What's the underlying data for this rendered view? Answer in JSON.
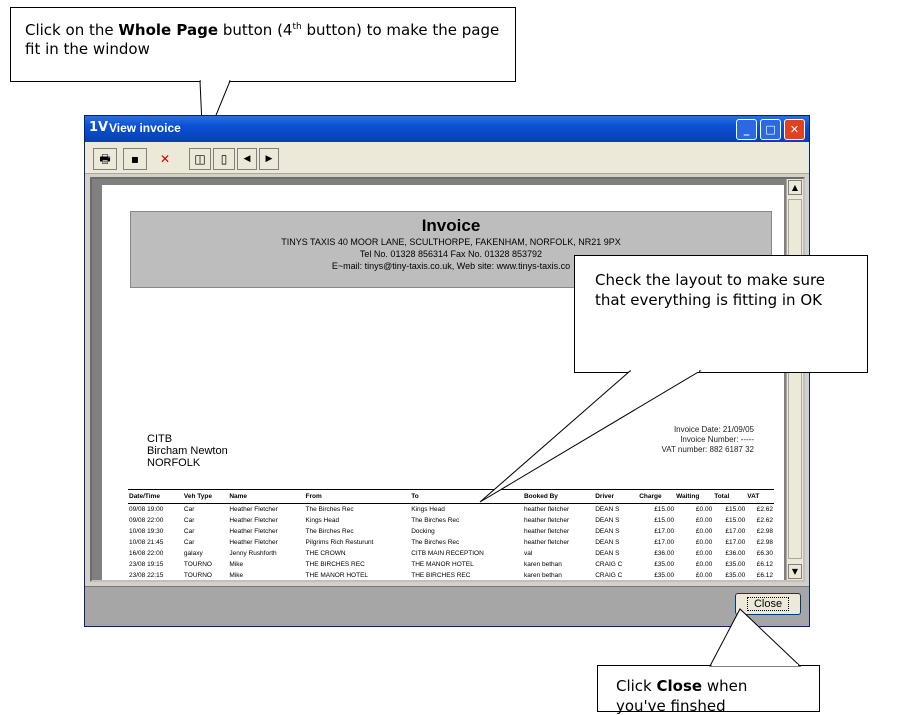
{
  "callouts": {
    "top": {
      "pre": "Click on the ",
      "bold": "Whole Page",
      "post1": " button (4",
      "sup": "th",
      "post2": " button) to make the page fit in the window"
    },
    "middle": {
      "text": "Check the layout to make sure that everything is fitting in OK"
    },
    "bottom": {
      "pre": "Click ",
      "bold": "Close",
      "post": " when you've finshed"
    }
  },
  "window": {
    "title": "View invoice",
    "icon": "1V"
  },
  "toolbar": {
    "buttons": [
      "printer-icon",
      "save-icon",
      "delete-icon",
      "whole-page-icon",
      "page-icon",
      "prev-icon",
      "next-icon"
    ]
  },
  "invoice": {
    "title": "Invoice",
    "line1": "TINYS TAXIS  40 MOOR LANE, SCULTHORPE, FAKENHAM, NORFOLK, NR21 9PX",
    "line2": "Tel No. 01328 856314 Fax No. 01328 853792",
    "line3": "E~mail: tinys@tiny-taxis.co.uk,  Web site:  www.tinys-taxis.co",
    "address": [
      "CITB",
      "Bircham Newton",
      "NORFOLK"
    ],
    "invoice_date": "Invoice Date: 21/09/05",
    "invoice_number": "Invoice Number: -----",
    "vat_number": "VAT number: 882 6187 32",
    "columns": [
      "Date/Time",
      "Veh Type",
      "Name",
      "From",
      "To",
      "Booked By",
      "Driver",
      "Charge",
      "Waiting",
      "Total",
      "VAT"
    ],
    "rows": [
      [
        "09/08 19:00",
        "Car",
        "Heather Fletcher",
        "The Birches Rec",
        "Kings Head",
        "heather fletcher",
        "DEAN S",
        "£15.00",
        "£0.00",
        "£15.00",
        "£2.62"
      ],
      [
        "09/08 22:00",
        "Car",
        "Heather Fletcher",
        "Kings Head",
        "The Birches Rec",
        "heather fletcher",
        "DEAN S",
        "£15.00",
        "£0.00",
        "£15.00",
        "£2.62"
      ],
      [
        "10/08 19:30",
        "Car",
        "Heather Fletcher",
        "The Birches Rec",
        "Docking",
        "heather fletcher",
        "DEAN S",
        "£17.00",
        "£0.00",
        "£17.00",
        "£2.98"
      ],
      [
        "10/08 21:45",
        "Car",
        "Heather Fletcher",
        "Pilgrims Rich Resturunt",
        "The Birches Rec",
        "heather fletcher",
        "DEAN S",
        "£17.00",
        "£0.00",
        "£17.00",
        "£2.98"
      ],
      [
        "16/08 22:00",
        "galaxy",
        "Jenny Rushforth",
        "THE CROWN",
        "CITB MAIN RECEPTION",
        "val",
        "DEAN S",
        "£36.00",
        "£0.00",
        "£36.00",
        "£6.30"
      ],
      [
        "23/08 19:15",
        "TOURNO",
        "Mike",
        "THE BIRCHES REC",
        "THE MANOR HOTEL",
        "karen bethan",
        "CRAIG C",
        "£35.00",
        "£0.00",
        "£35.00",
        "£6.12"
      ],
      [
        "23/08 22:15",
        "TOURNO",
        "Mike",
        "THE MANOR HOTEL",
        "THE BIRCHES REC",
        "karen bethan",
        "CRAIG C",
        "£35.00",
        "£0.00",
        "£35.00",
        "£6.12"
      ]
    ]
  },
  "close_label": "Close"
}
